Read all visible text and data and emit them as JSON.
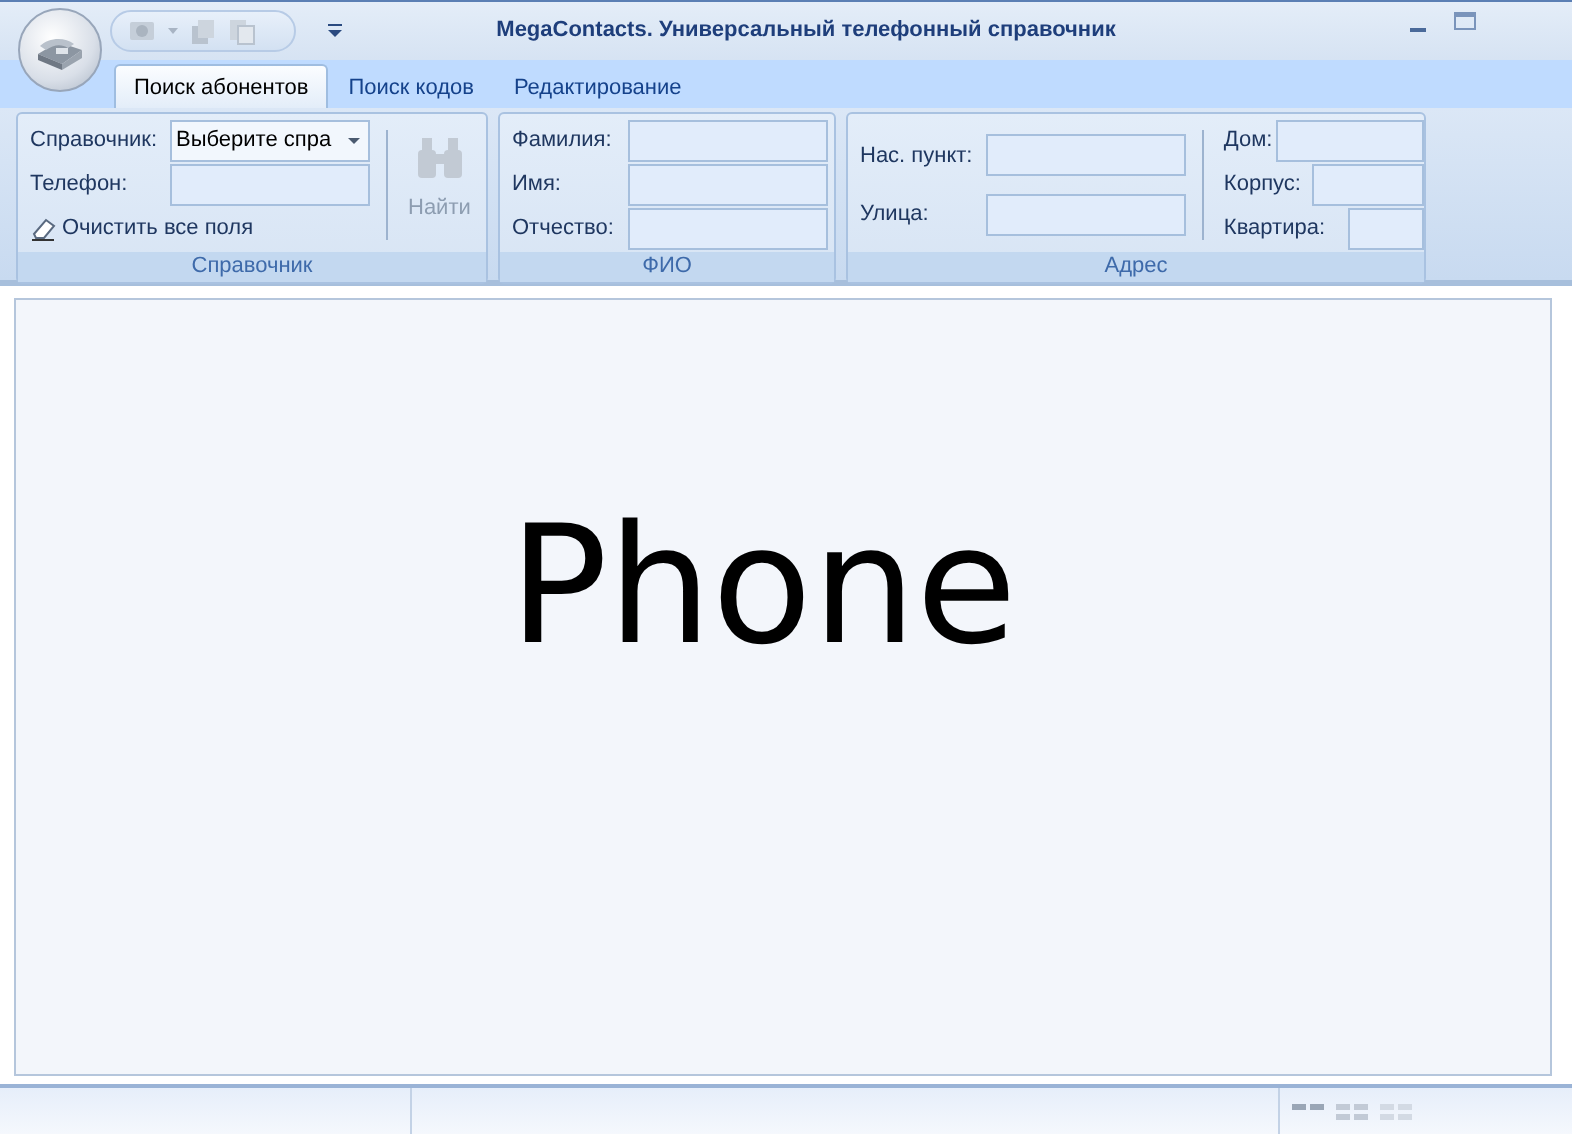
{
  "window": {
    "title": "MegaContacts. Универсальный телефонный справочник"
  },
  "tabs": [
    {
      "label": "Поиск абонентов",
      "selected": true
    },
    {
      "label": "Поиск кодов",
      "selected": false
    },
    {
      "label": "Редактирование",
      "selected": false
    }
  ],
  "directory_group": {
    "title": "Справочник",
    "directory": {
      "label": "Справочник:",
      "value": "Выберите спра"
    },
    "phone": {
      "label": "Телефон:"
    },
    "clear_link": "Очистить все поля",
    "find_button": {
      "label": "Найти",
      "disabled": true
    }
  },
  "name_group": {
    "title": "ФИО",
    "fields": [
      {
        "label": "Фамилия:"
      },
      {
        "label": "Имя:"
      },
      {
        "label": "Отчество:"
      }
    ]
  },
  "address_group": {
    "title": "Адрес",
    "left_fields": [
      {
        "label": "Нас. пункт:"
      },
      {
        "label": "Улица:"
      }
    ],
    "right_fields": [
      {
        "label": "Дом:"
      },
      {
        "label": "Корпус:"
      },
      {
        "label": "Квартира:"
      }
    ]
  },
  "content": {
    "text": "Phone"
  }
}
